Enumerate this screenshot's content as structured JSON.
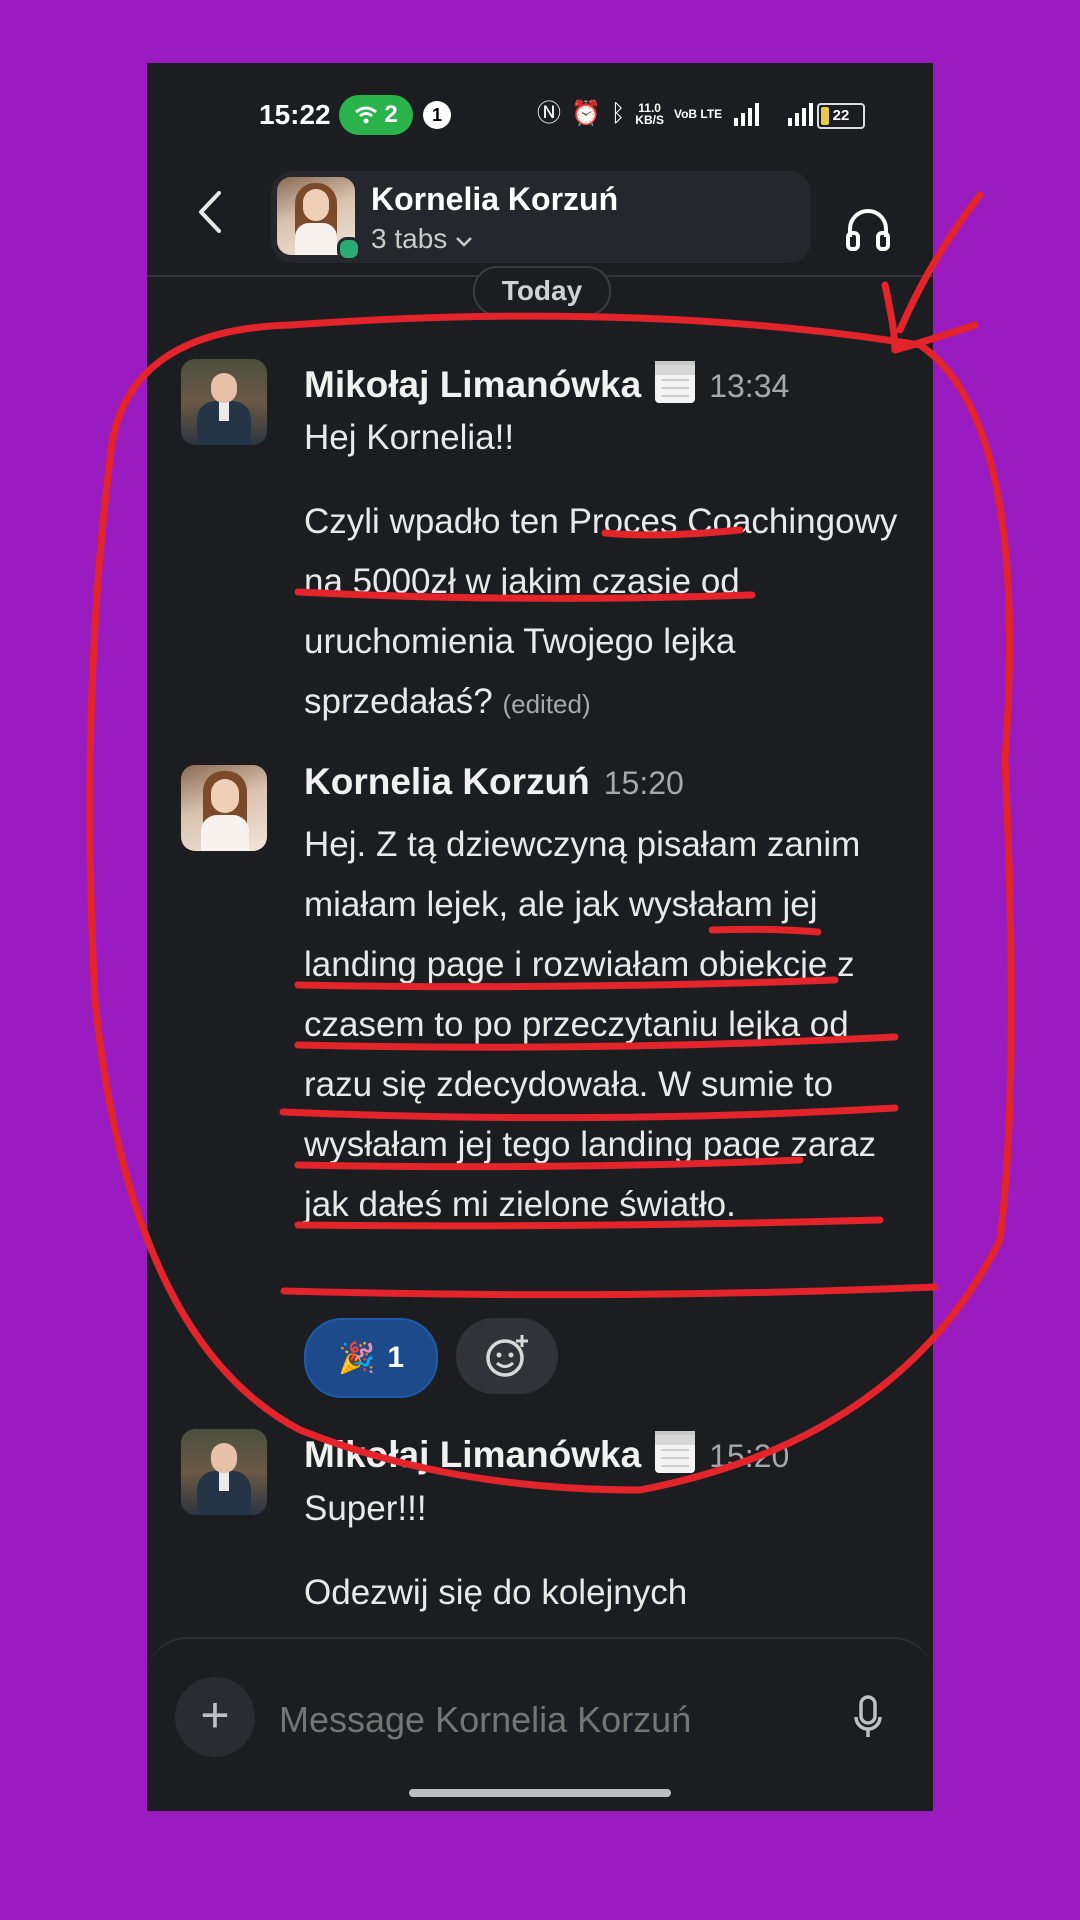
{
  "status_bar": {
    "time": "15:22",
    "hotspot_count": "2",
    "notification_count": "1",
    "net_speed": "11.0",
    "net_unit": "KB/S",
    "volte": "VoB LTE",
    "battery": "22"
  },
  "header": {
    "contact_name": "Kornelia Korzuń",
    "subtitle": "3 tabs"
  },
  "divider": {
    "label": "Today"
  },
  "messages": [
    {
      "author": "Mikołaj Limanówka",
      "time": "13:34",
      "paragraphs": [
        "Hej Kornelia!!",
        "Czyli wpadło ten Proces Coachingowy na 5000zł w jakim czasie od uruchomienia Twojego lejka sprzedałaś?"
      ],
      "edited": "(edited)"
    },
    {
      "author": "Kornelia Korzuń",
      "time": "15:20",
      "paragraphs": [
        "Hej. Z tą dziewczyną pisałam zanim miałam lejek, ale jak wysłałam jej landing page i rozwiałam obiekcje z czasem to po przeczytaniu lejka od razu się zdecydowała. W sumie to wysłałam jej tego landing page zaraz jak dałeś mi zielone światło."
      ],
      "reaction": {
        "emoji": "🎉",
        "count": "1"
      }
    },
    {
      "author": "Mikołaj Limanówka",
      "time": "15:20",
      "paragraphs": [
        "Super!!!",
        "Odezwij się do kolejnych"
      ]
    }
  ],
  "composer": {
    "placeholder": "Message Kornelia Korzuń"
  },
  "colors": {
    "background": "#9a1cc0",
    "app_bg": "#1b1d21",
    "annotation": "#e3242b",
    "reaction_bg": "#1d4a8a",
    "presence": "#2bac76"
  }
}
